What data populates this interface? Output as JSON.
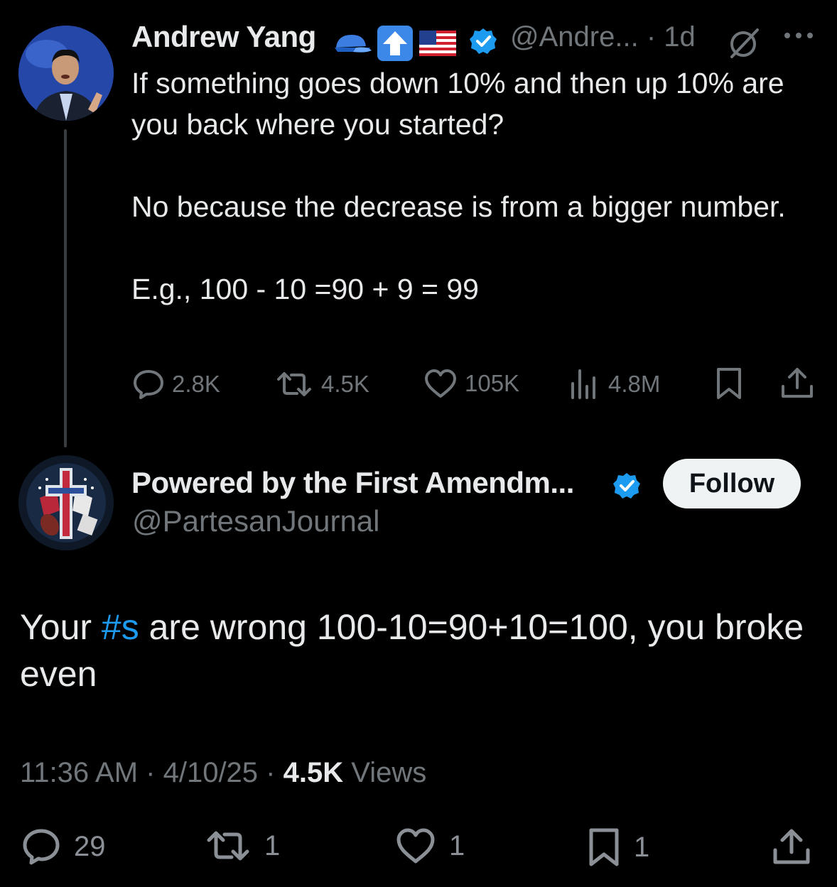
{
  "tweet": {
    "author_name": "Andrew Yang",
    "handle": "@Andre...",
    "time": "· 1d",
    "text": "If something goes down 10% and then up 10% are you back where you started?\n\nNo because the decrease is from a bigger number.\n\nE.g., 100 - 10 =90 + 9 = 99",
    "stats": {
      "replies": "2.8K",
      "reposts": "4.5K",
      "likes": "105K",
      "views": "4.8M"
    }
  },
  "reply": {
    "author_name": "Powered by the First Amendm...",
    "handle": "@PartesanJournal",
    "follow_label": "Follow",
    "text_before": "Your ",
    "hashtag": "#s",
    "text_after": " are wrong 100-10=90+10=100, you broke even",
    "time": "11:36 AM",
    "date": "4/10/25",
    "views_count": "4.5K",
    "views_label": "Views",
    "stats": {
      "replies": "29",
      "reposts": "1",
      "likes": "1",
      "bookmarks": "1"
    }
  },
  "colors": {
    "background": "#000000",
    "text": "#e7e9ea",
    "muted": "#71767b",
    "link": "#1d9bf0",
    "verified": "#1d9bf0"
  }
}
